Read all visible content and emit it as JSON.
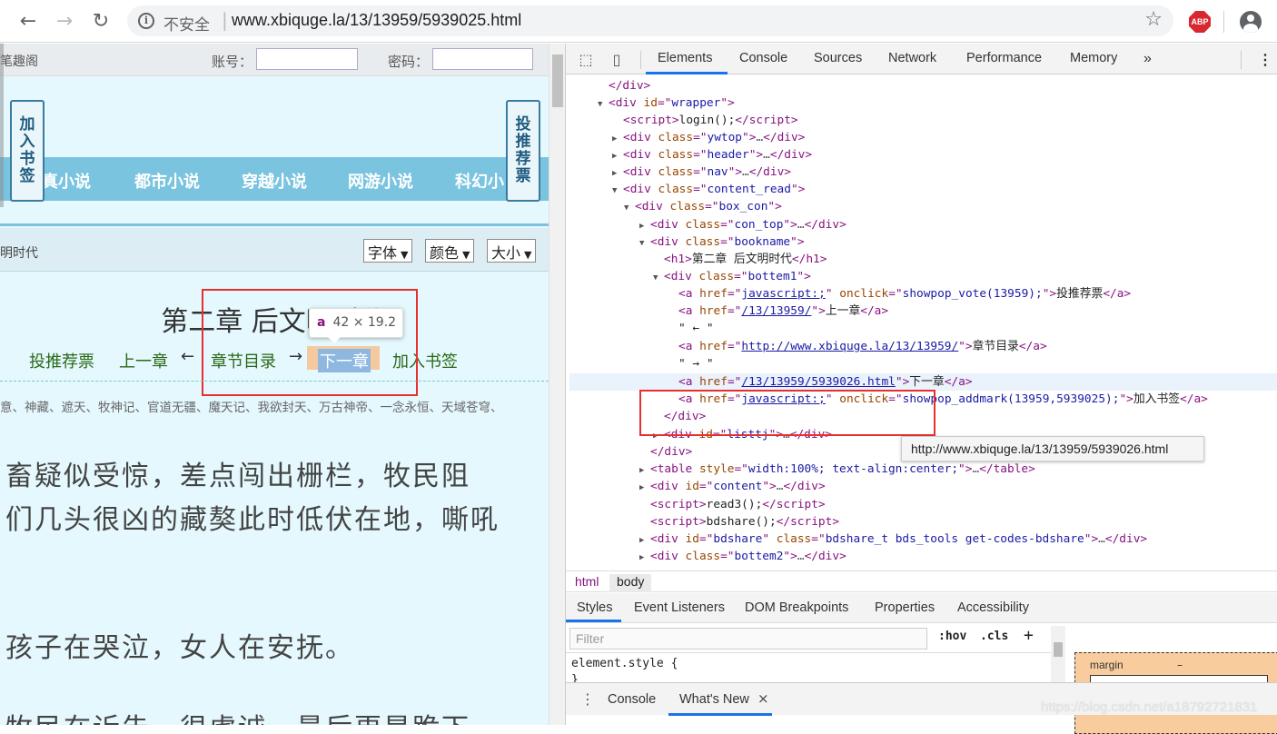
{
  "browser": {
    "back_icon": "arrow-left-icon",
    "forward_icon": "arrow-right-icon",
    "reload_icon": "reload-icon",
    "insecure_label": "不安全",
    "url": "www.xbiquge.la/13/13959/5939025.html",
    "star_icon": "star-icon",
    "abp_label": "ABP",
    "account_icon": "account-icon"
  },
  "page": {
    "site_name": "笔趣阁",
    "account_label": "账号：",
    "password_label": "密码：",
    "bookmark_tab": "加入书签",
    "vote_tab": "投推荐票",
    "nav": [
      "真小说",
      "都市小说",
      "穿越小说",
      "网游小说",
      "科幻小"
    ],
    "chapter_crumb": "明时代",
    "font_select": "字体",
    "color_select": "颜色",
    "size_select": "大小",
    "chapter_title": "第二章 后文明时代",
    "links": {
      "vote": "投推荐票",
      "prev": "上一章",
      "left_arrow": "←",
      "toc": "章节目录",
      "right_arrow": "→",
      "next": "下一章",
      "bookmark": "加入书签"
    },
    "tooltip_tag": "a",
    "tooltip_size": "42 × 19.2",
    "recommend": "意、神藏、遮天、牧神记、官道无疆、魔天记、我欲封天、万古神帝、一念永恒、天域苍穹、",
    "paragraphs": [
      "畜疑似受惊，差点闯出栅栏，牧民阻",
      "们几头很凶的藏獒此时低伏在地，嘶吼",
      "孩子在哭泣，女人在安抚。",
      "牧民在诉告，很虔诚，最后更是跪下"
    ]
  },
  "devtools": {
    "tabs": [
      "Elements",
      "Console",
      "Sources",
      "Network",
      "Performance",
      "Memory"
    ],
    "more_icon": "chevron-double-right-icon",
    "menu_icon": "kebab-menu-icon",
    "inspect_icon": "inspect-icon",
    "device_icon": "device-icon",
    "dom": {
      "close_div": "</div>",
      "wrapper_id": "wrapper",
      "login_script": "login();",
      "ywtop": "ywtop",
      "header": "header",
      "nav": "nav",
      "content_read": "content_read",
      "box_con": "box_con",
      "con_top": "con_top",
      "bookname": "bookname",
      "h1_text": "第二章 后文明时代",
      "bottem1": "bottem1",
      "js_href": "javascript:;",
      "vote_onclick": "showpop_vote(13959);",
      "vote_text": "投推荐票",
      "prev_href": "/13/13959/",
      "prev_text": "上一章",
      "arrow_left": "\" ← \"",
      "toc_href": "http://www.xbiquge.la/13/13959/",
      "toc_text": "章节目录",
      "arrow_right": "\" → \"",
      "next_href": "/13/13959/5939026.html",
      "next_text": "下一章",
      "addmark_onclick": "showpop_addmark(13959,5939025);",
      "addmark_text": "加入书签",
      "listtj": "listtj",
      "table_style": "width:100%; text-align:center;",
      "content_id": "content",
      "read3": "read3();",
      "bdshare_fn": "bdshare();",
      "bdshare_id": "bdshare",
      "bdshare_class": "bdshare_t bds_tools get-codes-bdshare",
      "bottem2": "bottem2"
    },
    "link_tooltip": "http://www.xbiquge.la/13/13959/5939026.html",
    "breadcrumbs": [
      "html",
      "body"
    ],
    "sub_tabs": [
      "Styles",
      "Event Listeners",
      "DOM Breakpoints",
      "Properties",
      "Accessibility"
    ],
    "filter_placeholder": "Filter",
    "hov": ":hov",
    "cls": ".cls",
    "plus": "+",
    "element_style": "element.style {",
    "close_brace": "}",
    "box_margin_label": "margin",
    "box_margin_value": "–",
    "drawer_tabs": [
      "Console",
      "What's New"
    ],
    "drawer_close": "×"
  },
  "watermark": "https://blog.csdn.net/a18792721831",
  "colors": {
    "page_bg": "#e4f8fd",
    "nav_blue": "#7ac4e0",
    "link_green": "#2a6818",
    "highlight_red": "#e63030",
    "devtools_accent": "#1a73e8"
  }
}
